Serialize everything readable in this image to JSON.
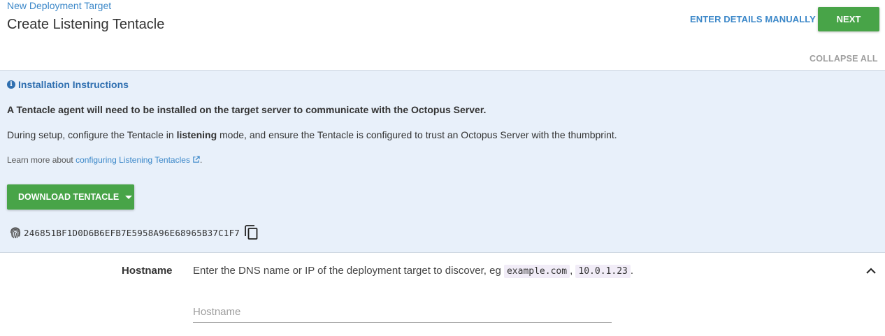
{
  "header": {
    "breadcrumb": "New Deployment Target",
    "title": "Create Listening Tentacle",
    "enter_manually_label": "ENTER DETAILS MANUALLY",
    "next_label": "NEXT",
    "collapse_all_label": "COLLAPSE ALL"
  },
  "instructions": {
    "title": "Installation Instructions",
    "bold_line": "A Tentacle agent will need to be installed on the target server to communicate with the Octopus Server.",
    "setup_prefix": "During setup, configure the Tentacle in ",
    "setup_bold": "listening",
    "setup_suffix": " mode, and ensure the Tentacle is configured to trust an Octopus Server with the thumbprint.",
    "learn_prefix": "Learn more about ",
    "learn_link": "configuring Listening Tentacles",
    "learn_suffix": ".",
    "download_label": "DOWNLOAD TENTACLE",
    "thumbprint": "246851BF1D0D6B6EFB7E5958A96E68965B37C1F7"
  },
  "hostname": {
    "label": "Hostname",
    "description_prefix": "Enter the DNS name or IP of the deployment target to discover, eg ",
    "example1": "example.com",
    "separator": ", ",
    "example2": "10.0.1.23",
    "description_suffix": ".",
    "placeholder": "Hostname",
    "value": ""
  },
  "colors": {
    "accent_green": "#48a448",
    "link_blue": "#3c88c9",
    "info_background": "#e8f0fa"
  },
  "icons": [
    "info-icon",
    "external-link-icon",
    "caret-down-icon",
    "fingerprint-icon",
    "copy-icon",
    "chevron-up-icon"
  ]
}
